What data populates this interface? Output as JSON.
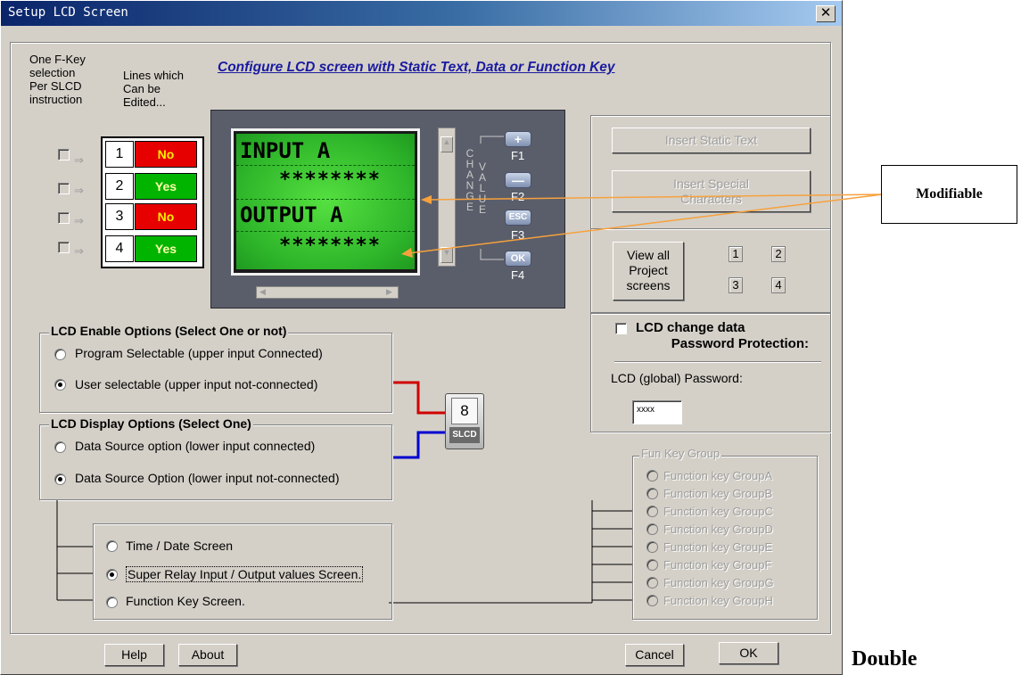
{
  "window": {
    "title": "Setup LCD Screen",
    "close_glyph": "✕"
  },
  "header": {
    "fkey_selection": [
      "One F-Key",
      "selection",
      "Per SLCD",
      "instruction"
    ],
    "lines_edited": [
      "Lines which",
      "Can be",
      "Edited..."
    ],
    "configure_title": "Configure LCD screen with Static Text, Data or Function Key"
  },
  "lines": [
    {
      "num": "1",
      "editable": "No"
    },
    {
      "num": "2",
      "editable": "Yes"
    },
    {
      "num": "3",
      "editable": "No"
    },
    {
      "num": "4",
      "editable": "Yes"
    }
  ],
  "lcd": {
    "line1": "INPUT A",
    "line2": "********",
    "line3": "OUTPUT A",
    "line4": "********",
    "change_letters": [
      "C",
      "H",
      "A",
      "N",
      "G",
      "E"
    ],
    "value_letters": [
      "V",
      "A",
      "L",
      "U",
      "E"
    ],
    "fkeys": [
      {
        "glyph": "+",
        "name": "F1"
      },
      {
        "glyph": "—",
        "name": "F2"
      },
      {
        "glyph": "ESC",
        "name": "F3"
      },
      {
        "glyph": "OK",
        "name": "F4"
      }
    ]
  },
  "right_panel": {
    "insert_static": "Insert Static Text",
    "insert_special": [
      "Insert Special",
      "Characters"
    ],
    "view_all": [
      "View all",
      "Project",
      "screens"
    ],
    "screen_nums": [
      "1",
      "2",
      "3",
      "4"
    ],
    "password_chk": [
      "LCD change data",
      "Password Protection:"
    ],
    "global_password_label": "LCD (global) Password:",
    "password_value": "xxxx"
  },
  "enable_options": {
    "title": "LCD Enable Options (Select One or not)",
    "opt1": "Program Selectable (upper input Connected)",
    "opt2": "User selectable (upper input not-connected)"
  },
  "display_options": {
    "title": "LCD Display Options (Select One)",
    "opt1": "Data Source option (lower input connected)",
    "opt2": "Data Source Option (lower input not-connected)"
  },
  "slcd": {
    "number": "8",
    "label": "SLCD"
  },
  "screen_options": {
    "opt1": "Time / Date Screen",
    "opt2": "Super Relay Input / Output values Screen.",
    "opt3": "Function Key Screen."
  },
  "fun_key_group": {
    "title": "Fun Key Group",
    "items": [
      "Function key GroupA",
      "Function key GroupB",
      "Function key GroupC",
      "Function key GroupD",
      "Function key GroupE",
      "Function key GroupF",
      "Function key GroupG",
      "Function key GroupH"
    ]
  },
  "footer": {
    "help": "Help",
    "about": "About",
    "cancel": "Cancel",
    "ok": "OK"
  },
  "annotations": {
    "modifiable": "Modifiable",
    "double": "Double"
  },
  "colors": {
    "no_bg": "#e60000",
    "yes_bg": "#00b400",
    "lcd_green": "#33cc33",
    "arrow": "#f7a13d",
    "wire_red": "#d00000",
    "wire_blue": "#0000d0"
  }
}
